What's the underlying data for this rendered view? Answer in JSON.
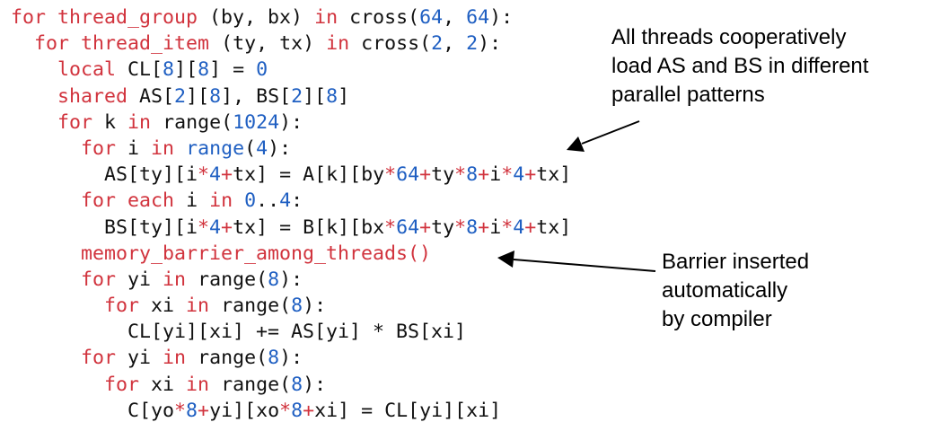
{
  "colors": {
    "keyword": "#d1333d",
    "number": "#1f5fc2",
    "text": "#111111",
    "annotation": "#000000"
  },
  "code_lines": [
    [
      {
        "t": "kw",
        "s": "for"
      },
      {
        "t": "plain",
        "s": " "
      },
      {
        "t": "kw",
        "s": "thread_group"
      },
      {
        "t": "plain",
        "s": " (by, bx) "
      },
      {
        "t": "kw",
        "s": "in"
      },
      {
        "t": "plain",
        "s": " cross("
      },
      {
        "t": "num",
        "s": "64"
      },
      {
        "t": "plain",
        "s": ", "
      },
      {
        "t": "num",
        "s": "64"
      },
      {
        "t": "plain",
        "s": "):"
      }
    ],
    [
      {
        "t": "plain",
        "s": "  "
      },
      {
        "t": "kw",
        "s": "for"
      },
      {
        "t": "plain",
        "s": " "
      },
      {
        "t": "kw",
        "s": "thread_item"
      },
      {
        "t": "plain",
        "s": " (ty, tx) "
      },
      {
        "t": "kw",
        "s": "in"
      },
      {
        "t": "plain",
        "s": " cross("
      },
      {
        "t": "num",
        "s": "2"
      },
      {
        "t": "plain",
        "s": ", "
      },
      {
        "t": "num",
        "s": "2"
      },
      {
        "t": "plain",
        "s": "):"
      }
    ],
    [
      {
        "t": "plain",
        "s": "    "
      },
      {
        "t": "kw",
        "s": "local"
      },
      {
        "t": "plain",
        "s": " CL["
      },
      {
        "t": "num",
        "s": "8"
      },
      {
        "t": "plain",
        "s": "]["
      },
      {
        "t": "num",
        "s": "8"
      },
      {
        "t": "plain",
        "s": "] = "
      },
      {
        "t": "num",
        "s": "0"
      }
    ],
    [
      {
        "t": "plain",
        "s": "    "
      },
      {
        "t": "kw",
        "s": "shared"
      },
      {
        "t": "plain",
        "s": " AS["
      },
      {
        "t": "num",
        "s": "2"
      },
      {
        "t": "plain",
        "s": "]["
      },
      {
        "t": "num",
        "s": "8"
      },
      {
        "t": "plain",
        "s": "], BS["
      },
      {
        "t": "num",
        "s": "2"
      },
      {
        "t": "plain",
        "s": "]["
      },
      {
        "t": "num",
        "s": "8"
      },
      {
        "t": "plain",
        "s": "]"
      }
    ],
    [
      {
        "t": "plain",
        "s": "    "
      },
      {
        "t": "kw",
        "s": "for"
      },
      {
        "t": "plain",
        "s": " k "
      },
      {
        "t": "kw",
        "s": "in"
      },
      {
        "t": "plain",
        "s": " range("
      },
      {
        "t": "num",
        "s": "1024"
      },
      {
        "t": "plain",
        "s": "):"
      }
    ],
    [
      {
        "t": "plain",
        "s": "      "
      },
      {
        "t": "kw",
        "s": "for"
      },
      {
        "t": "plain",
        "s": " i "
      },
      {
        "t": "kw",
        "s": "in"
      },
      {
        "t": "plain",
        "s": " "
      },
      {
        "t": "num",
        "s": "range"
      },
      {
        "t": "plain",
        "s": "("
      },
      {
        "t": "num",
        "s": "4"
      },
      {
        "t": "plain",
        "s": "):"
      }
    ],
    [
      {
        "t": "plain",
        "s": "        AS[ty][i"
      },
      {
        "t": "op",
        "s": "*"
      },
      {
        "t": "num",
        "s": "4"
      },
      {
        "t": "op",
        "s": "+"
      },
      {
        "t": "plain",
        "s": "tx] = A[k][by"
      },
      {
        "t": "op",
        "s": "*"
      },
      {
        "t": "num",
        "s": "64"
      },
      {
        "t": "op",
        "s": "+"
      },
      {
        "t": "plain",
        "s": "ty"
      },
      {
        "t": "op",
        "s": "*"
      },
      {
        "t": "num",
        "s": "8"
      },
      {
        "t": "op",
        "s": "+"
      },
      {
        "t": "plain",
        "s": "i"
      },
      {
        "t": "op",
        "s": "*"
      },
      {
        "t": "num",
        "s": "4"
      },
      {
        "t": "op",
        "s": "+"
      },
      {
        "t": "plain",
        "s": "tx]"
      }
    ],
    [
      {
        "t": "plain",
        "s": "      "
      },
      {
        "t": "kw",
        "s": "for"
      },
      {
        "t": "plain",
        "s": " "
      },
      {
        "t": "kw",
        "s": "each"
      },
      {
        "t": "plain",
        "s": " i "
      },
      {
        "t": "kw",
        "s": "in"
      },
      {
        "t": "plain",
        "s": " "
      },
      {
        "t": "num",
        "s": "0"
      },
      {
        "t": "plain",
        "s": ".."
      },
      {
        "t": "num",
        "s": "4"
      },
      {
        "t": "plain",
        "s": ":"
      }
    ],
    [
      {
        "t": "plain",
        "s": "        BS[ty][i"
      },
      {
        "t": "op",
        "s": "*"
      },
      {
        "t": "num",
        "s": "4"
      },
      {
        "t": "op",
        "s": "+"
      },
      {
        "t": "plain",
        "s": "tx] = B[k][bx"
      },
      {
        "t": "op",
        "s": "*"
      },
      {
        "t": "num",
        "s": "64"
      },
      {
        "t": "op",
        "s": "+"
      },
      {
        "t": "plain",
        "s": "ty"
      },
      {
        "t": "op",
        "s": "*"
      },
      {
        "t": "num",
        "s": "8"
      },
      {
        "t": "op",
        "s": "+"
      },
      {
        "t": "plain",
        "s": "i"
      },
      {
        "t": "op",
        "s": "*"
      },
      {
        "t": "num",
        "s": "4"
      },
      {
        "t": "op",
        "s": "+"
      },
      {
        "t": "plain",
        "s": "tx]"
      }
    ],
    [
      {
        "t": "plain",
        "s": "      "
      },
      {
        "t": "fn",
        "s": "memory_barrier_among_threads()"
      }
    ],
    [
      {
        "t": "plain",
        "s": "      "
      },
      {
        "t": "kw",
        "s": "for"
      },
      {
        "t": "plain",
        "s": " yi "
      },
      {
        "t": "kw",
        "s": "in"
      },
      {
        "t": "plain",
        "s": " range("
      },
      {
        "t": "num",
        "s": "8"
      },
      {
        "t": "plain",
        "s": "):"
      }
    ],
    [
      {
        "t": "plain",
        "s": "        "
      },
      {
        "t": "kw",
        "s": "for"
      },
      {
        "t": "plain",
        "s": " xi "
      },
      {
        "t": "kw",
        "s": "in"
      },
      {
        "t": "plain",
        "s": " range("
      },
      {
        "t": "num",
        "s": "8"
      },
      {
        "t": "plain",
        "s": "):"
      }
    ],
    [
      {
        "t": "plain",
        "s": "          CL[yi][xi] += AS[yi] * BS[xi]"
      }
    ],
    [
      {
        "t": "plain",
        "s": "      "
      },
      {
        "t": "kw",
        "s": "for"
      },
      {
        "t": "plain",
        "s": " yi "
      },
      {
        "t": "kw",
        "s": "in"
      },
      {
        "t": "plain",
        "s": " range("
      },
      {
        "t": "num",
        "s": "8"
      },
      {
        "t": "plain",
        "s": "):"
      }
    ],
    [
      {
        "t": "plain",
        "s": "        "
      },
      {
        "t": "kw",
        "s": "for"
      },
      {
        "t": "plain",
        "s": " xi "
      },
      {
        "t": "kw",
        "s": "in"
      },
      {
        "t": "plain",
        "s": " range("
      },
      {
        "t": "num",
        "s": "8"
      },
      {
        "t": "plain",
        "s": "):"
      }
    ],
    [
      {
        "t": "plain",
        "s": "          C[yo"
      },
      {
        "t": "op",
        "s": "*"
      },
      {
        "t": "num",
        "s": "8"
      },
      {
        "t": "op",
        "s": "+"
      },
      {
        "t": "plain",
        "s": "yi][xo"
      },
      {
        "t": "op",
        "s": "*"
      },
      {
        "t": "num",
        "s": "8"
      },
      {
        "t": "op",
        "s": "+"
      },
      {
        "t": "plain",
        "s": "xi] = CL[yi][xi]"
      }
    ]
  ],
  "annotations": {
    "top": [
      "All threads cooperatively",
      "load AS and BS in different",
      "parallel patterns"
    ],
    "bottom": [
      "Barrier inserted",
      "automatically",
      "by compiler"
    ]
  }
}
